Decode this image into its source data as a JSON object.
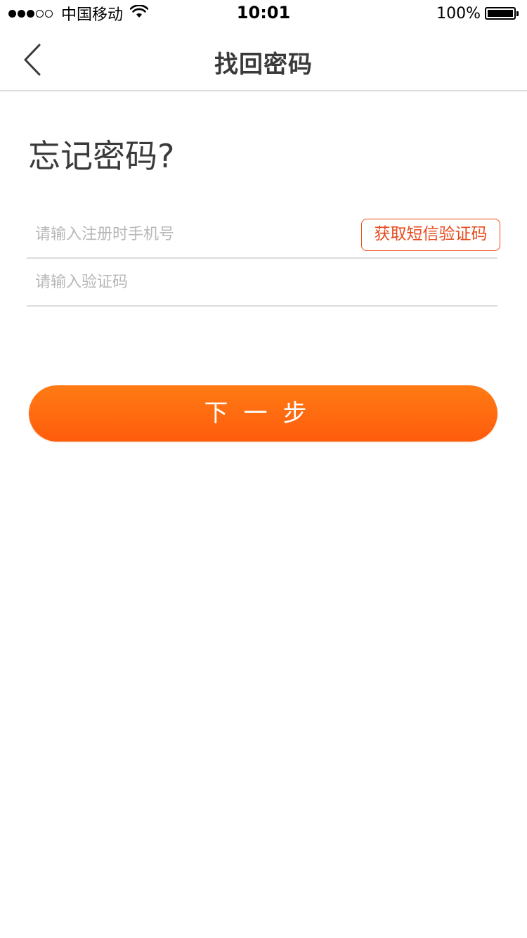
{
  "status_bar": {
    "carrier": "中国移动",
    "time": "10:01",
    "battery": "100%",
    "signal_bars_filled": 3,
    "signal_bars_total": 5
  },
  "nav": {
    "title": "找回密码",
    "back_icon": "chevron-left-icon"
  },
  "main": {
    "heading": "忘记密码?",
    "phone_field": {
      "value": "",
      "placeholder": "请输入注册时手机号"
    },
    "sms_button_label": "获取短信验证码",
    "code_field": {
      "value": "",
      "placeholder": "请输入验证码"
    },
    "next_button_label": "下一步"
  },
  "colors": {
    "accent": "#ff6a10",
    "sms_border": "#f04b17",
    "divider": "#dcdcdc",
    "title_text": "#3a3a3a",
    "placeholder": "#b8b8b8"
  }
}
